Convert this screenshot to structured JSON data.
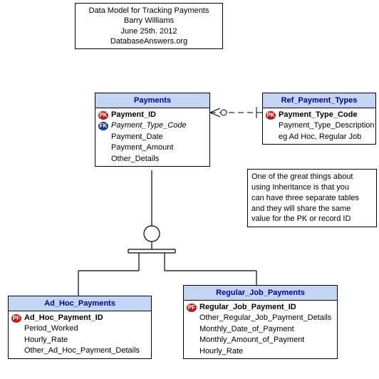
{
  "header": {
    "line1": "Data Model for Tracking Payments",
    "line2": "Barry Williams",
    "line3": "June  25th.  2012",
    "line4": "DatabaseAnswers.org"
  },
  "entities": {
    "payments": {
      "title": "Payments",
      "attrs": [
        {
          "key": "PK",
          "name": "Payment_ID",
          "bold": true
        },
        {
          "key": "FK",
          "name": "Payment_Type_Code",
          "italic": true
        },
        {
          "key": "",
          "name": "Payment_Date"
        },
        {
          "key": "",
          "name": "Payment_Amount"
        },
        {
          "key": "",
          "name": "Other_Details"
        }
      ]
    },
    "ref_payment_types": {
      "title": "Ref_Payment_Types",
      "attrs": [
        {
          "key": "PK",
          "name": "Payment_Type_Code",
          "bold": true
        },
        {
          "key": "",
          "name": "Payment_Type_Description"
        },
        {
          "key": "",
          "name": "eg Ad Hoc, Regular Job"
        }
      ]
    },
    "ad_hoc_payments": {
      "title": "Ad_Hoc_Payments",
      "attrs": [
        {
          "key": "PF",
          "name": "Ad_Hoc_Payment_ID",
          "bold": true
        },
        {
          "key": "",
          "name": "Period_Worked"
        },
        {
          "key": "",
          "name": "Hourly_Rate"
        },
        {
          "key": "",
          "name": "Other_Ad_Hoc_Payment_Details"
        }
      ]
    },
    "regular_job_payments": {
      "title": "Regular_Job_Payments",
      "attrs": [
        {
          "key": "PF",
          "name": "Regular_Job_Payment_ID",
          "bold": true
        },
        {
          "key": "",
          "name": "Other_Regular_Job_Payment_Details"
        },
        {
          "key": "",
          "name": "Monthly_Date_of_Payment"
        },
        {
          "key": "",
          "name": "Monthly_Amount_of_Payment"
        },
        {
          "key": "",
          "name": "Hourly_Rate"
        }
      ]
    }
  },
  "note": {
    "line1": "One of the great things about",
    "line2": "using Inheritance is that you",
    "line3": "can have three separate tables",
    "line4": "and they will share the same",
    "line5": "value for the PK or record ID"
  }
}
